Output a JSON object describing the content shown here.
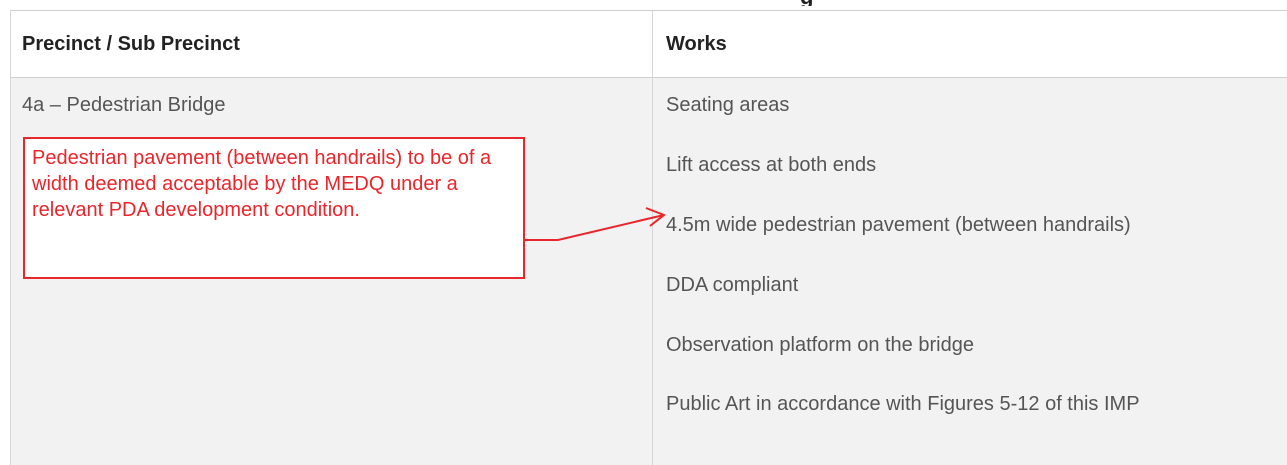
{
  "table": {
    "headers": {
      "precinct": "Precinct / Sub Precinct",
      "works": "Works"
    },
    "rows": [
      {
        "precinct": "4a – Pedestrian Bridge",
        "works": [
          "Seating areas",
          "Lift access at both ends",
          "4.5m wide pedestrian pavement (between handrails)",
          "DDA compliant",
          "Observation platform on the bridge",
          "Public Art in accordance with Figures 5-12 of this IMP"
        ]
      }
    ]
  },
  "annotation": {
    "text": "Pedestrian pavement (between handrails) to be of a width deemed acceptable by the MEDQ under a relevant PDA development condition.",
    "color": "#e8262c"
  }
}
